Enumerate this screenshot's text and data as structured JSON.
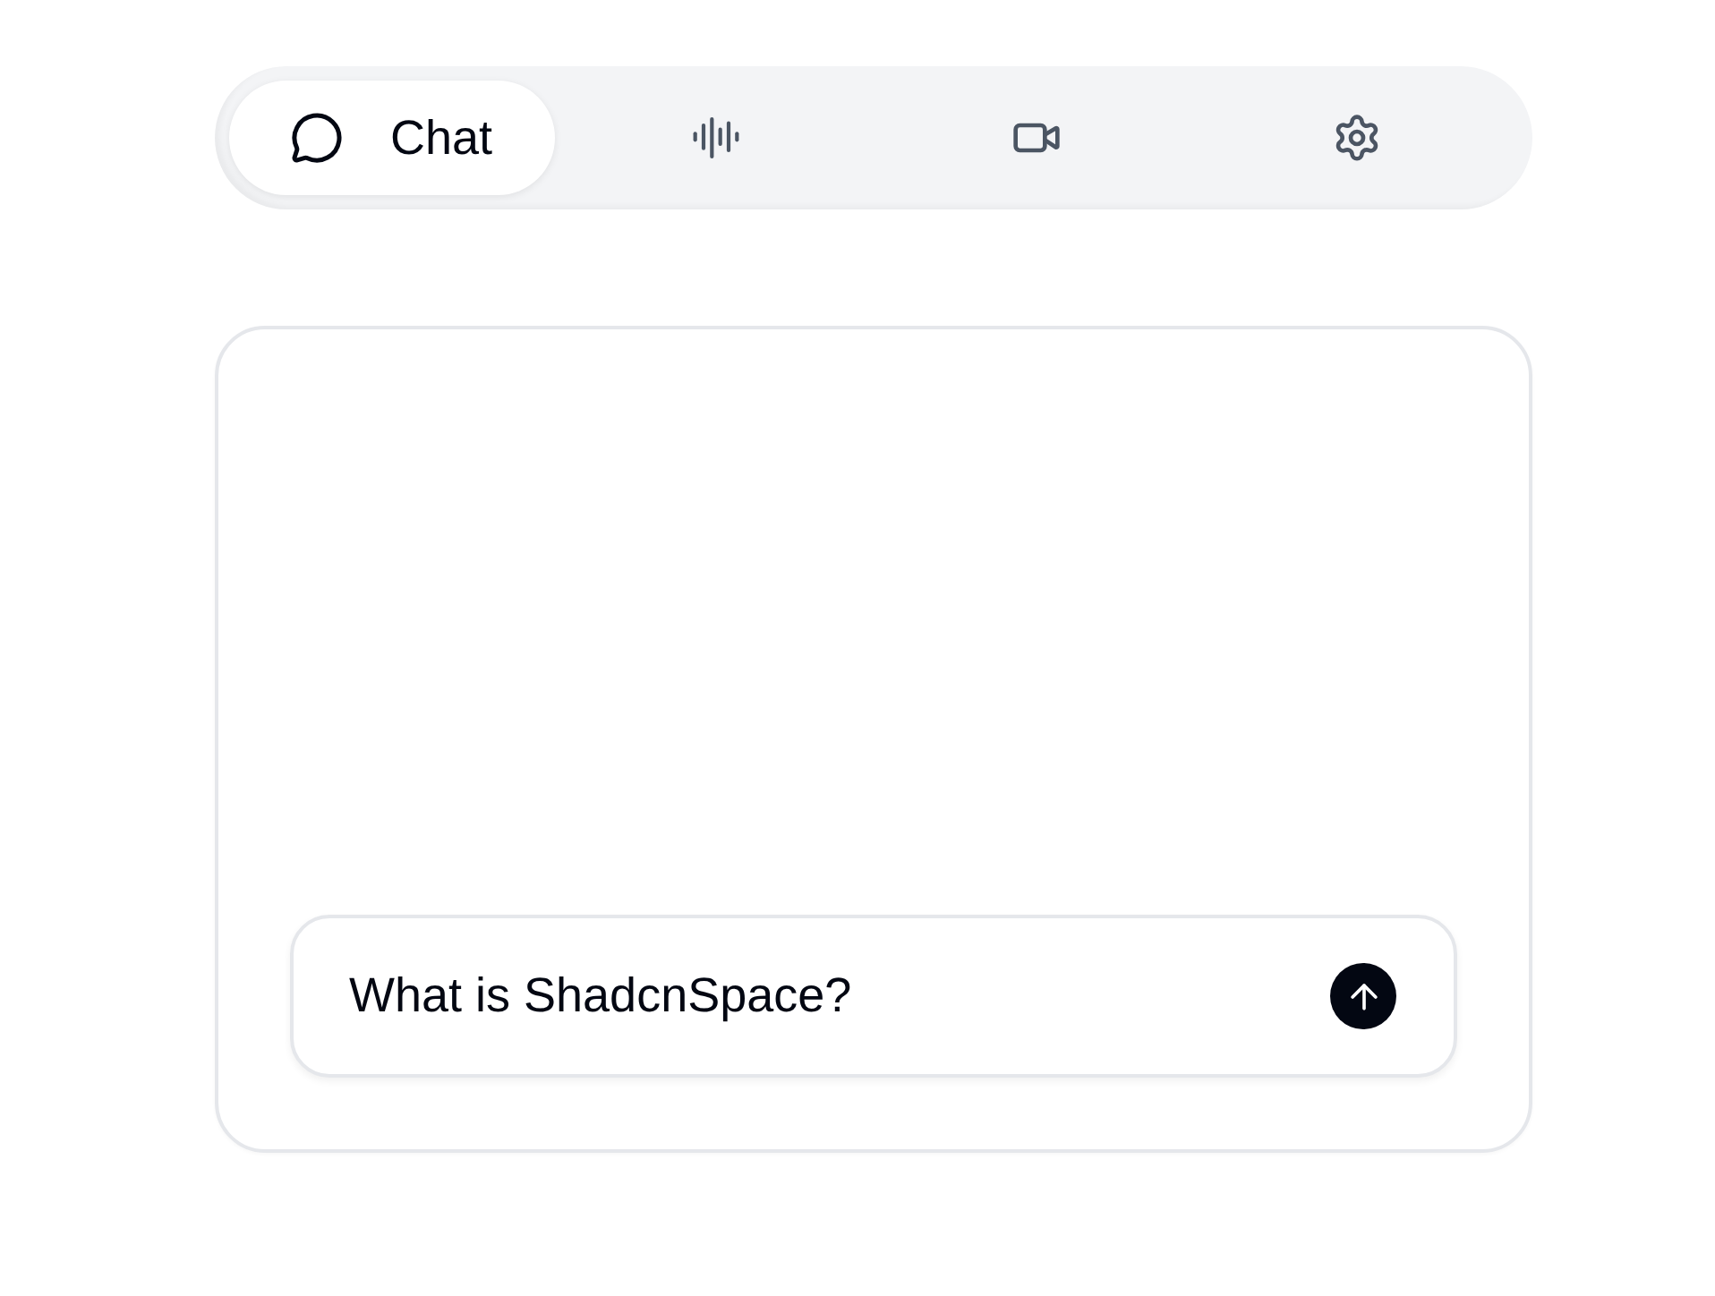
{
  "tabs": [
    {
      "kind": "chat",
      "label": "Chat",
      "selected": true
    },
    {
      "kind": "voice",
      "selected": false
    },
    {
      "kind": "video",
      "selected": false
    },
    {
      "kind": "settings",
      "selected": false
    }
  ],
  "chat_panel": {
    "input": {
      "value": "What is ShadcnSpace?"
    }
  }
}
